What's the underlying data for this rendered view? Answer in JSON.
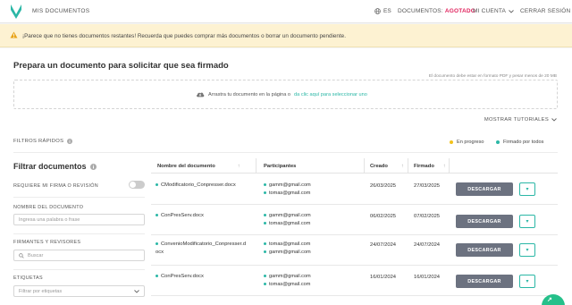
{
  "header": {
    "app_title": "MIS DOCUMENTOS",
    "language": "ES",
    "documents_label": "DOCUMENTOS:",
    "documents_status": "AGOTADO",
    "account": "MI CUENTA",
    "logout": "CERRAR SESIÓN",
    "brand_color": "#2bb7a6",
    "status_color": "#e0245e"
  },
  "banner": {
    "text": "¡Parece que no tienes documentos restantes! Recuerda que puedes comprar más documentos o borrar un documento pendiente.",
    "icon": "warning-icon"
  },
  "upload": {
    "title": "Prepara un documento para solicitar que sea firmado",
    "limit_note": "El documento debe estar en formato PDF y pesar menos de 20 MB",
    "drop_text": "Arrastra tu documento en la página o ",
    "drop_link": "da clic aquí para seleccionar uno",
    "tutorials": "MOSTRAR TUTORIALES"
  },
  "quick_filters": {
    "label": "FILTROS RÁPIDOS",
    "in_progress": "En progreso",
    "signed_all": "Firmado por todos",
    "in_progress_color": "#f2c21b",
    "signed_color": "#2bb7a6"
  },
  "filters": {
    "title": "Filtrar documentos",
    "requires_sign": "REQUIERE MI FIRMA O REVISIÓN",
    "doc_name_label": "NOMBRE DEL DOCUMENTO",
    "doc_name_placeholder": "Ingresa una palabra o frase",
    "signers_label": "FIRMANTES Y REVISORES",
    "signers_placeholder": "Buscar",
    "tags_label": "ETIQUETAS",
    "tags_placeholder": "Filtrar por etiquetas"
  },
  "table": {
    "columns": [
      "Nombre del documento",
      "Participantes",
      "Creado",
      "Firmado"
    ],
    "download_label": "DESCARGAR",
    "rows": [
      {
        "name": "CModificatorio_Conpresser.docx",
        "participants": [
          "gamm@gmail.com",
          "tomas@gmail.com"
        ],
        "created": "26/03/2025",
        "signed": "27/03/2025"
      },
      {
        "name": "ConPresServ.docx",
        "participants": [
          "gamm@gmail.com",
          "tomas@gmail.com"
        ],
        "created": "06/02/2025",
        "signed": "07/02/2025"
      },
      {
        "name": "ConvenioModificatorio_Conpresser.d ocx",
        "participants": [
          "tomas@gmail.com",
          "gamm@gmail.com"
        ],
        "created": "24/07/2024",
        "signed": "24/07/2024"
      },
      {
        "name": "ConPresServ.docx",
        "participants": [
          "gamm@gmail.com",
          "tomas@gmail.com"
        ],
        "created": "16/01/2024",
        "signed": "16/01/2024"
      }
    ]
  }
}
